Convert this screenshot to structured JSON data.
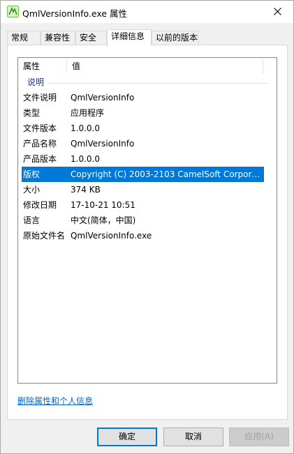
{
  "window": {
    "title": "QmlVersionInfo.exe 属性",
    "close_glyph": "✕"
  },
  "tabs": [
    {
      "label": "常规"
    },
    {
      "label": "兼容性"
    },
    {
      "label": "安全"
    },
    {
      "label": "详细信息",
      "active": true
    },
    {
      "label": "以前的版本"
    }
  ],
  "details": {
    "columns": {
      "property": "属性",
      "value": "值"
    },
    "group": "说明",
    "rows": [
      {
        "property": "文件说明",
        "value": "QmlVersionInfo"
      },
      {
        "property": "类型",
        "value": "应用程序"
      },
      {
        "property": "文件版本",
        "value": "1.0.0.0"
      },
      {
        "property": "产品名称",
        "value": "QmlVersionInfo"
      },
      {
        "property": "产品版本",
        "value": "1.0.0.0"
      },
      {
        "property": "版权",
        "value": "Copyright (C) 2003-2103 CamelSoft Corpora...",
        "selected": true
      },
      {
        "property": "大小",
        "value": "374 KB"
      },
      {
        "property": "修改日期",
        "value": "17-10-21 10:51"
      },
      {
        "property": "语言",
        "value": "中文(简体，中国)"
      },
      {
        "property": "原始文件名",
        "value": "QmlVersionInfo.exe"
      }
    ]
  },
  "remove_link": "删除属性和个人信息",
  "buttons": {
    "ok": "确定",
    "cancel": "取消",
    "apply": "应用(A)"
  },
  "colors": {
    "selection": "#0078d7",
    "link": "#0066cc",
    "group_label": "#1e3287"
  }
}
